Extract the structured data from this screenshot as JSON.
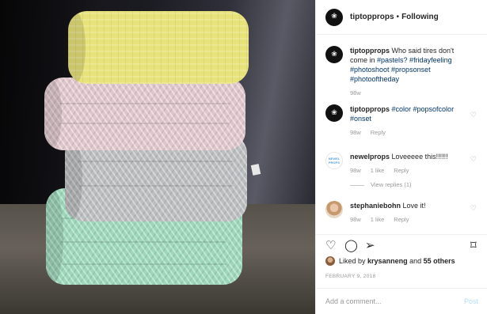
{
  "header": {
    "username": "tiptopprops",
    "separator": "•",
    "follow_status": "Following"
  },
  "caption": {
    "username": "tiptopprops",
    "text": "Who said tires don't come in",
    "hashtags": "#pastels? #fridayfeeling #photoshoot #propsonset #photooftheday",
    "age": "98w"
  },
  "comments": [
    {
      "username": "tiptopprops",
      "text": "#color #popsofcolor #onset",
      "age": "98w",
      "reply_label": "Reply"
    },
    {
      "username": "newelprops",
      "text": "Loveeeee this!!!!!!",
      "age": "98w",
      "likes": "1 like",
      "reply_label": "Reply",
      "view_replies": "View replies (1)",
      "avatar_text": [
        "NEWEL",
        "PROPS"
      ]
    },
    {
      "username": "stephaniebohn",
      "text": "Love it!",
      "age": "98w",
      "likes": "1 like",
      "reply_label": "Reply"
    }
  ],
  "likes": {
    "prefix": "Liked by",
    "user": "krysanneng",
    "middle": "and",
    "others": "55 others"
  },
  "date": "FEBRUARY 9, 2018",
  "add_comment": {
    "placeholder": "Add a comment...",
    "post_label": "Post"
  },
  "icons": {
    "like": "heart-icon",
    "comment": "comment-icon",
    "share": "share-icon",
    "save": "bookmark-icon",
    "comment_like": "heart-icon"
  },
  "colors": {
    "hashtag": "#003569",
    "meta": "#999999",
    "post_disabled": "#b2dffc",
    "tire_yellow": "#e8e27a",
    "tire_pink": "#ecd3d8",
    "tire_gray": "#c7cacb",
    "tire_mint": "#a8e3c6"
  }
}
